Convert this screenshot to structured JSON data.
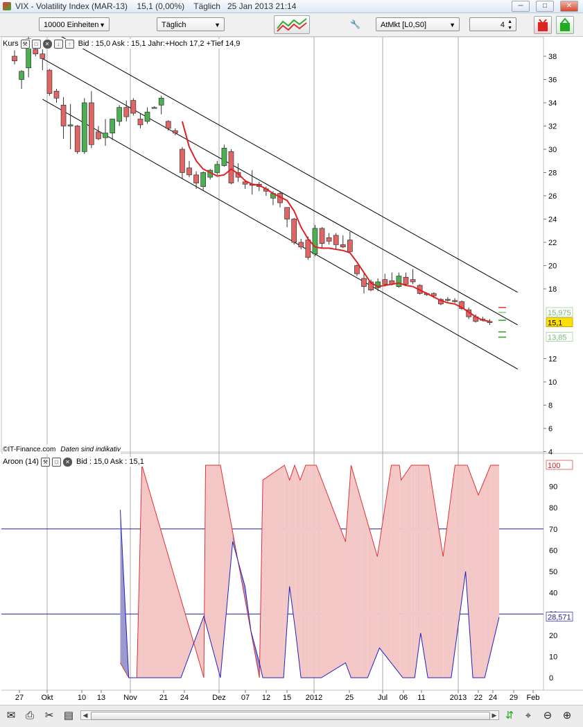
{
  "window": {
    "title": "VIX - Volatility Index (MAR-13)",
    "quote": "15,1 (0,00%)",
    "period": "Täglich",
    "datetime": "25 Jan 2013 21:14"
  },
  "toolbar": {
    "units": "10000 Einheiten",
    "interval": "Täglich",
    "market": "AtMkt [L0,S0]",
    "quantity": "4"
  },
  "price_panel": {
    "label": "Kurs",
    "info": "Bid : 15,0 Ask : 15,1 Jahr:+Hoch 17,2 +Tief 14,9",
    "copyright": "©IT-Finance.com",
    "disclaimer": "Daten sind indikativ",
    "last_price": "15,1",
    "price_tag_top": "15,975",
    "price_tag_bottom": "13,85",
    "colors": {
      "up": "#4caf50",
      "down": "#e06666",
      "trend": "#e02020",
      "channel": "#000000"
    }
  },
  "aroon_panel": {
    "label": "Aroon (14)",
    "info": "Bid : 15,0 Ask : 15,1",
    "tag_up": "100",
    "tag_down": "28,571",
    "colors": {
      "up": "#e03030",
      "down": "#2020c0",
      "fill_up": "#f4c7c7",
      "fill_down": "#9a9acd"
    }
  },
  "x_axis": {
    "labels": [
      "27",
      "Okt",
      "10",
      "13",
      "Nov",
      "21",
      "24",
      "Dez",
      "07",
      "12",
      "15",
      "2012",
      "25",
      "Jul",
      "06",
      "11",
      "2013",
      "22",
      "24",
      "29",
      "Feb"
    ]
  },
  "chart_data": [
    {
      "type": "candlestick",
      "title": "VIX - Volatility Index (MAR-13)",
      "y_ticks": [
        38,
        36,
        34,
        32,
        30,
        28,
        26,
        24,
        22,
        20,
        18,
        12,
        10,
        8,
        6,
        4
      ],
      "ylim": [
        4,
        39
      ],
      "candles": [
        {
          "o": 38,
          "h": 38.5,
          "l": 37.3,
          "c": 37.6
        },
        {
          "o": 36,
          "h": 36.8,
          "l": 35.2,
          "c": 36.7
        },
        {
          "o": 37,
          "h": 40,
          "l": 36.2,
          "c": 39.5
        },
        {
          "o": 38.6,
          "h": 39,
          "l": 38,
          "c": 38.2
        },
        {
          "o": 38.2,
          "h": 38.6,
          "l": 36.8,
          "c": 37.8
        },
        {
          "o": 36.8,
          "h": 36.9,
          "l": 34.6,
          "c": 34.8
        },
        {
          "o": 35,
          "h": 35.2,
          "l": 34,
          "c": 34.4
        },
        {
          "o": 33.8,
          "h": 34.5,
          "l": 30.9,
          "c": 32
        },
        {
          "o": 32,
          "h": 33.9,
          "l": 30,
          "c": 32.1
        },
        {
          "o": 32,
          "h": 32.1,
          "l": 29.6,
          "c": 29.8
        },
        {
          "o": 29.8,
          "h": 34.4,
          "l": 29.6,
          "c": 34
        },
        {
          "o": 34,
          "h": 35,
          "l": 30.1,
          "c": 30.4
        },
        {
          "o": 31.5,
          "h": 32,
          "l": 30.8,
          "c": 30.9
        },
        {
          "o": 31,
          "h": 32.6,
          "l": 30.3,
          "c": 31.4
        },
        {
          "o": 31.4,
          "h": 32.6,
          "l": 30.8,
          "c": 32.6
        },
        {
          "o": 32.4,
          "h": 33.8,
          "l": 32,
          "c": 33.6
        },
        {
          "o": 33.6,
          "h": 34.2,
          "l": 32.4,
          "c": 32.8
        },
        {
          "o": 34.2,
          "h": 34.4,
          "l": 32.9,
          "c": 33.1
        },
        {
          "o": 32.6,
          "h": 33.1,
          "l": 31.8,
          "c": 32.1
        },
        {
          "o": 32.4,
          "h": 33.6,
          "l": 32.2,
          "c": 33.2
        },
        {
          "o": 33.6,
          "h": 33.7,
          "l": 33.5,
          "c": 33.6
        },
        {
          "o": 33.8,
          "h": 34.6,
          "l": 33,
          "c": 34.4
        },
        {
          "o": 32.4,
          "h": 32.5,
          "l": 31.6,
          "c": 31.8
        },
        {
          "o": 31.6,
          "h": 31.8,
          "l": 31.2,
          "c": 31.4
        },
        {
          "o": 30,
          "h": 30.2,
          "l": 27.5,
          "c": 28
        },
        {
          "o": 28.4,
          "h": 29,
          "l": 27.6,
          "c": 27.8
        },
        {
          "o": 27.8,
          "h": 28.1,
          "l": 26.6,
          "c": 27.1
        },
        {
          "o": 26.8,
          "h": 28.1,
          "l": 26.5,
          "c": 28
        },
        {
          "o": 27.6,
          "h": 28.3,
          "l": 27.4,
          "c": 28.2
        },
        {
          "o": 28,
          "h": 29,
          "l": 27.8,
          "c": 28.7
        },
        {
          "o": 28.6,
          "h": 30.4,
          "l": 28.5,
          "c": 30.1
        },
        {
          "o": 29.8,
          "h": 30,
          "l": 27,
          "c": 27.1
        },
        {
          "o": 28,
          "h": 28.8,
          "l": 27.2,
          "c": 27.6
        },
        {
          "o": 27.2,
          "h": 27.4,
          "l": 26.6,
          "c": 27
        },
        {
          "o": 27,
          "h": 28.2,
          "l": 26.1,
          "c": 26.9
        },
        {
          "o": 27,
          "h": 27.2,
          "l": 26.4,
          "c": 26.8
        },
        {
          "o": 26.6,
          "h": 26.8,
          "l": 26,
          "c": 26.4
        },
        {
          "o": 25.8,
          "h": 26.4,
          "l": 25.2,
          "c": 26.2
        },
        {
          "o": 26.2,
          "h": 26.4,
          "l": 25,
          "c": 25.4
        },
        {
          "o": 25,
          "h": 25,
          "l": 23.3,
          "c": 24
        },
        {
          "o": 24,
          "h": 24.1,
          "l": 21.8,
          "c": 22
        },
        {
          "o": 22,
          "h": 22.3,
          "l": 21.4,
          "c": 21.6
        },
        {
          "o": 22.2,
          "h": 22.5,
          "l": 20.5,
          "c": 20.7
        },
        {
          "o": 21,
          "h": 23.5,
          "l": 20.8,
          "c": 23.2
        },
        {
          "o": 23.2,
          "h": 23.3,
          "l": 21.5,
          "c": 21.9
        },
        {
          "o": 22.4,
          "h": 22.8,
          "l": 21.8,
          "c": 22.1
        },
        {
          "o": 22.6,
          "h": 22.8,
          "l": 21.4,
          "c": 21.8
        },
        {
          "o": 21.8,
          "h": 22.6,
          "l": 21.5,
          "c": 21.6
        },
        {
          "o": 22.2,
          "h": 22.9,
          "l": 21.2,
          "c": 21.2
        },
        {
          "o": 20,
          "h": 20.1,
          "l": 19.1,
          "c": 19.3
        },
        {
          "o": 18.9,
          "h": 19.3,
          "l": 17.6,
          "c": 18.2
        },
        {
          "o": 18.6,
          "h": 18.8,
          "l": 17.8,
          "c": 17.9
        },
        {
          "o": 18.1,
          "h": 18.9,
          "l": 17.8,
          "c": 18.6
        },
        {
          "o": 18.8,
          "h": 19.3,
          "l": 18.2,
          "c": 18.4
        },
        {
          "o": 18.7,
          "h": 19.4,
          "l": 18.3,
          "c": 18.4
        },
        {
          "o": 18.2,
          "h": 19.4,
          "l": 18.1,
          "c": 19.1
        },
        {
          "o": 19,
          "h": 19.4,
          "l": 18.3,
          "c": 18.4
        },
        {
          "o": 18.8,
          "h": 19.7,
          "l": 18.4,
          "c": 18.6
        },
        {
          "o": 18.3,
          "h": 18.4,
          "l": 17.5,
          "c": 17.6
        },
        {
          "o": 17.6,
          "h": 17.7,
          "l": 17.4,
          "c": 17.5
        },
        {
          "o": 17.6,
          "h": 17.7,
          "l": 17.2,
          "c": 17.4
        },
        {
          "o": 17.1,
          "h": 17.2,
          "l": 16.6,
          "c": 16.7
        },
        {
          "o": 17.1,
          "h": 17.3,
          "l": 16.9,
          "c": 17.1
        },
        {
          "o": 17,
          "h": 17.2,
          "l": 16.8,
          "c": 16.9
        },
        {
          "o": 16.9,
          "h": 17,
          "l": 16.2,
          "c": 16.3
        },
        {
          "o": 16.2,
          "h": 16.4,
          "l": 15.4,
          "c": 15.6
        },
        {
          "o": 15.6,
          "h": 15.8,
          "l": 15.1,
          "c": 15.2
        },
        {
          "o": 15.4,
          "h": 15.6,
          "l": 15.2,
          "c": 15.3
        },
        {
          "o": 15.2,
          "h": 15.4,
          "l": 14.9,
          "c": 15.1
        }
      ],
      "trend_line": [
        [
          24,
          32.4
        ],
        [
          25,
          30.2
        ],
        [
          26,
          29
        ],
        [
          27,
          28.3
        ],
        [
          28,
          28
        ],
        [
          29,
          27.7
        ],
        [
          30,
          27.8
        ],
        [
          31,
          28.3
        ],
        [
          32,
          27.9
        ],
        [
          33,
          27.3
        ],
        [
          34,
          27
        ],
        [
          35,
          26.9
        ],
        [
          36,
          26.6
        ],
        [
          37,
          26.2
        ],
        [
          38,
          25.9
        ],
        [
          39,
          25.6
        ],
        [
          40,
          24.7
        ],
        [
          41,
          23.3
        ],
        [
          42,
          22.3
        ],
        [
          43,
          21.6
        ],
        [
          44,
          21.5
        ],
        [
          45,
          21.5
        ],
        [
          46,
          21.4
        ],
        [
          47,
          21.3
        ],
        [
          48,
          21.1
        ],
        [
          49,
          20.3
        ],
        [
          50,
          19.4
        ],
        [
          51,
          18.5
        ],
        [
          52,
          18.2
        ],
        [
          53,
          18.3
        ],
        [
          54,
          18.4
        ],
        [
          55,
          18.5
        ],
        [
          56,
          18.3
        ],
        [
          57,
          18.2
        ],
        [
          58,
          17.9
        ],
        [
          59,
          17.6
        ],
        [
          60,
          17.3
        ],
        [
          61,
          17
        ],
        [
          62,
          16.8
        ],
        [
          63,
          16.7
        ],
        [
          64,
          16.4
        ],
        [
          65,
          16
        ],
        [
          66,
          15.6
        ],
        [
          67,
          15.3
        ],
        [
          68,
          15.2
        ]
      ],
      "channels": [
        {
          "from": [
            4,
            40.6
          ],
          "to": [
            72,
            17.7
          ]
        },
        {
          "from": [
            4,
            37.8
          ],
          "to": [
            72,
            14.9
          ]
        },
        {
          "from": [
            4,
            34.3
          ],
          "to": [
            72,
            11.1
          ]
        }
      ]
    },
    {
      "type": "line",
      "title": "Aroon (14)",
      "y_ticks": [
        100,
        90,
        80,
        70,
        60,
        50,
        40,
        30,
        20,
        10,
        0
      ],
      "ylim": [
        -5,
        105
      ],
      "reference_lines": [
        70,
        30
      ],
      "series": [
        {
          "name": "Aroon up",
          "x": [
            10.7,
            12.7,
            14.6,
            15.8,
            30.4,
            30.8,
            34.3,
            43.5,
            44.3,
            49.4,
            50.6,
            51.8,
            53.1,
            54.4,
            55.7,
            56.9,
            63.8,
            65.1,
            71.3,
            74.6,
            76.5,
            76.9,
            79.3,
            80.7,
            83.4,
            86.8,
            89.6,
            92.5,
            95.1,
            98,
            100
          ],
          "y": [
            7,
            0,
            0,
            100,
            0,
            100,
            100,
            0,
            93,
            100,
            93,
            100,
            93,
            100,
            100,
            100,
            64,
            100,
            57,
            100,
            100,
            93,
            100,
            100,
            100,
            57,
            100,
            100,
            86,
            100,
            100
          ]
        },
        {
          "name": "Aroon down",
          "x": [
            10.7,
            12.7,
            14.6,
            25,
            30.4,
            34.3,
            37.2,
            40.1,
            41.5,
            43.5,
            44.3,
            49.2,
            50.6,
            52,
            53.3,
            55.1,
            56.9,
            58.1,
            63.8,
            65.1,
            66.4,
            67,
            67.5,
            69,
            71.8,
            77.3,
            78,
            80.1,
            81.5,
            83.2,
            87.1,
            88.7,
            92.1,
            93.8,
            96.6,
            100
          ],
          "y": [
            79,
            0,
            0,
            0,
            29,
            0,
            64,
            43,
            22,
            7,
            0,
            0,
            43,
            22,
            0,
            0,
            0,
            0,
            7,
            0,
            0,
            0,
            0,
            0,
            14,
            0,
            0,
            0,
            21,
            0,
            0,
            0,
            50,
            0,
            0,
            28.5
          ]
        }
      ]
    }
  ]
}
